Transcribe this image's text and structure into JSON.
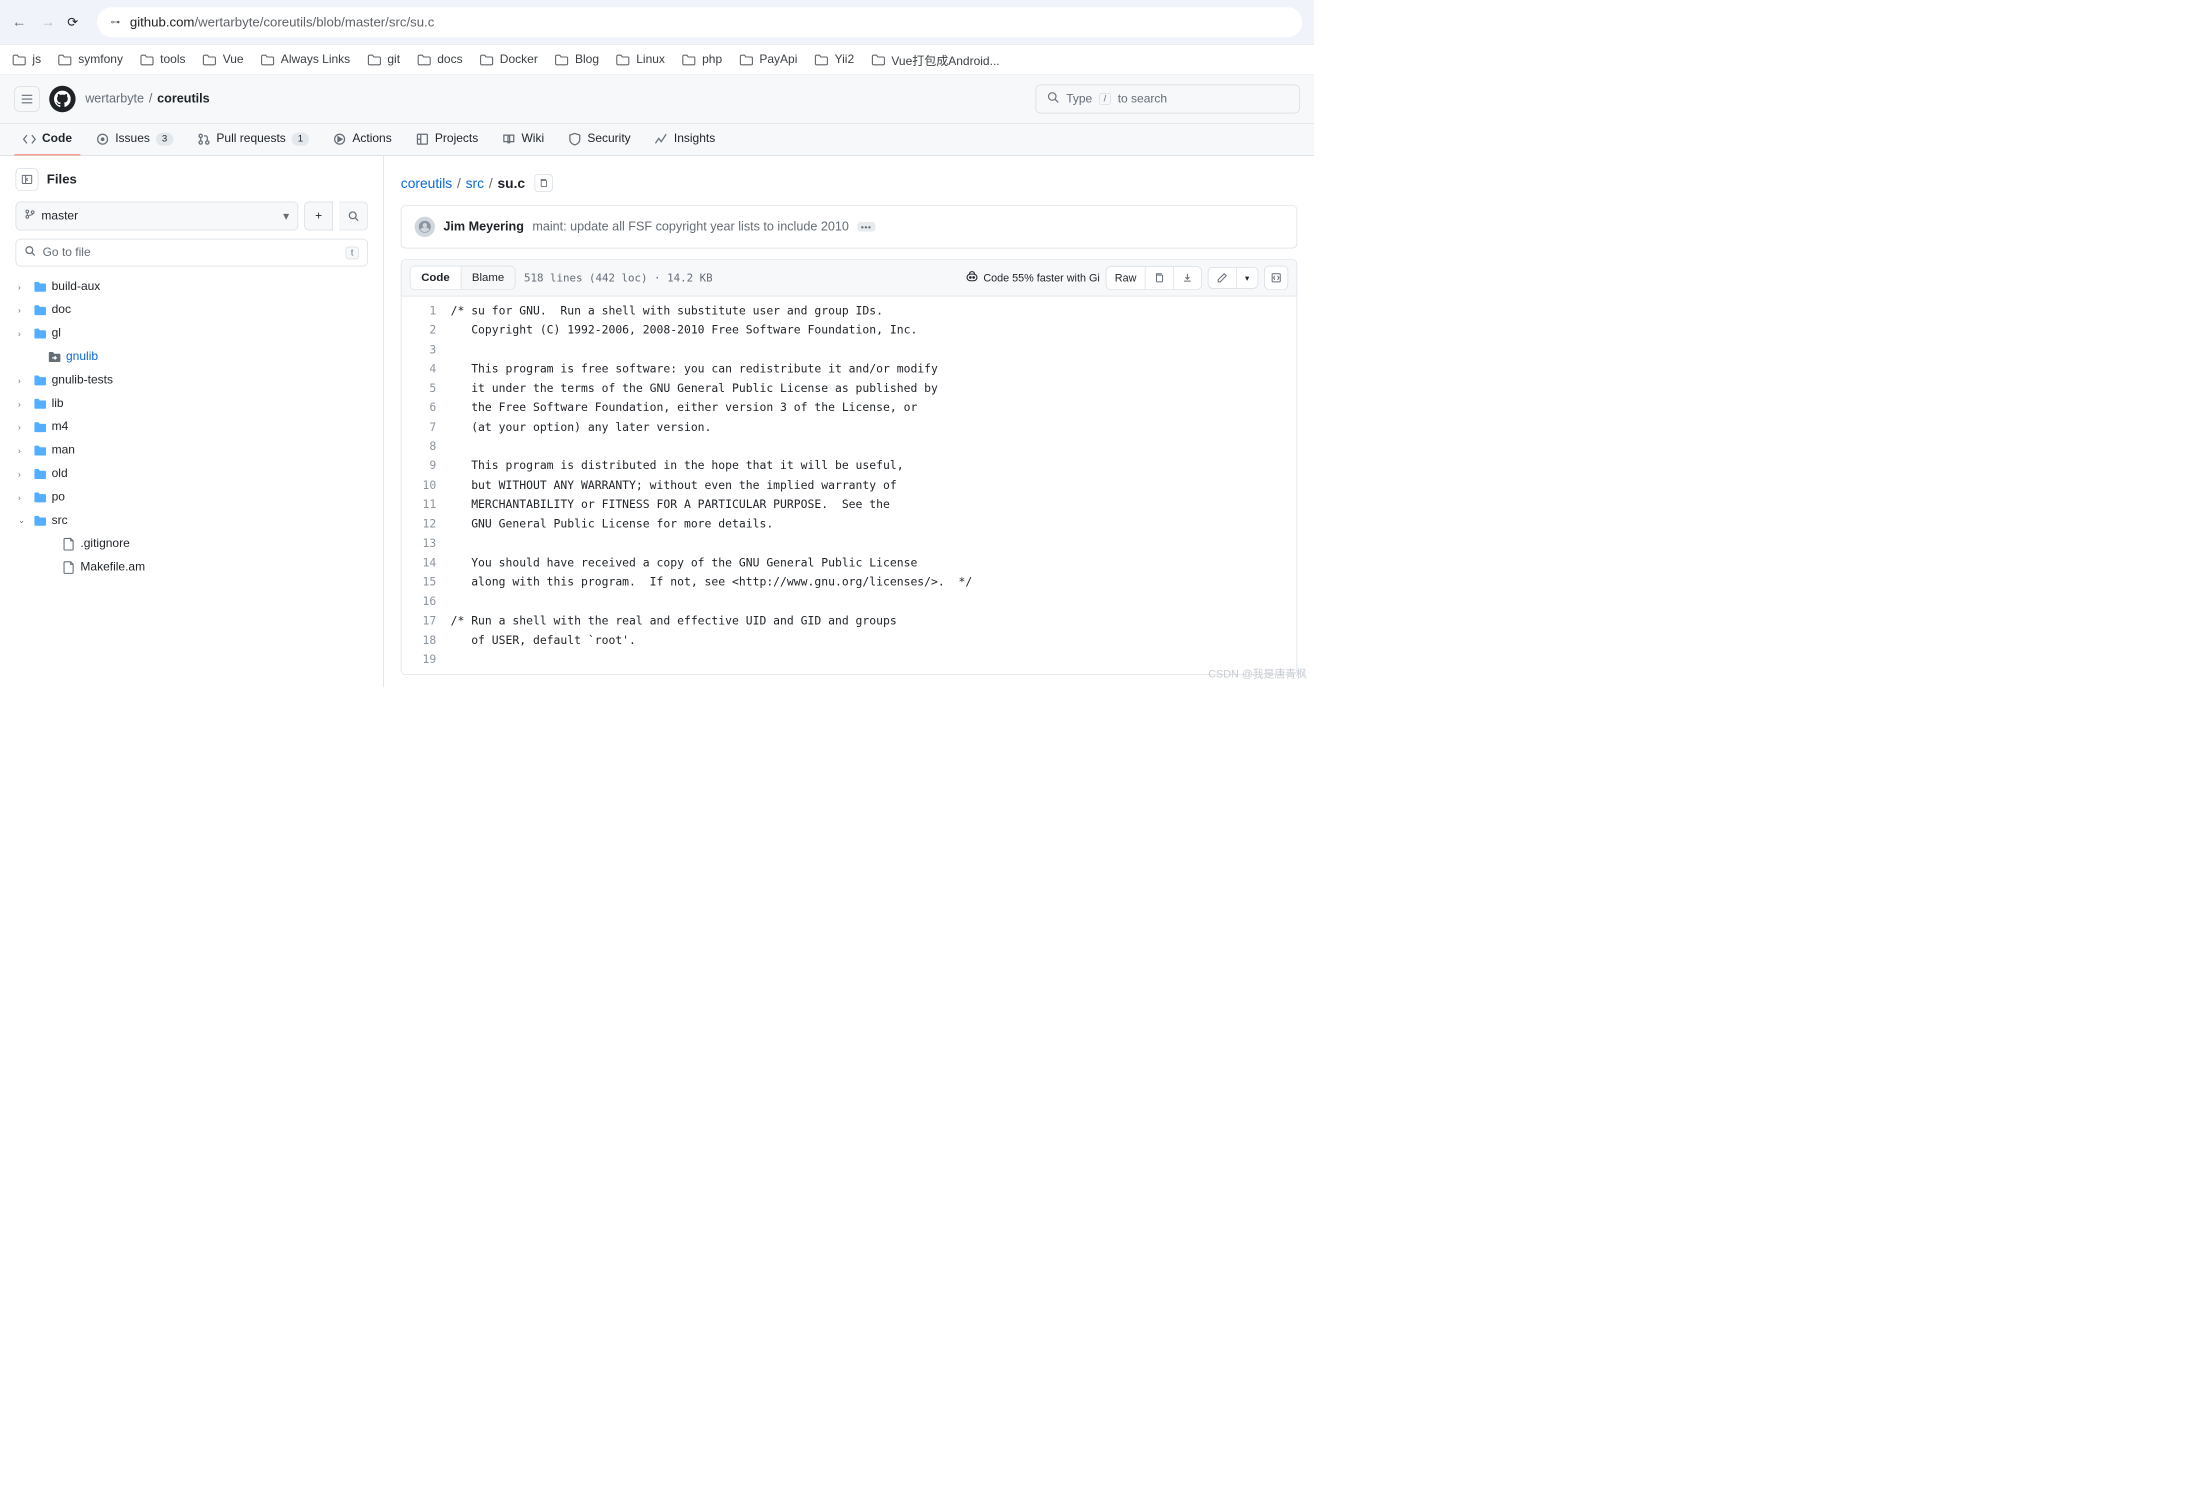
{
  "browser": {
    "url_domain": "github.com",
    "url_path": "/wertarbyte/coreutils/blob/master/src/su.c",
    "bookmarks": [
      "js",
      "symfony",
      "tools",
      "Vue",
      "Always Links",
      "git",
      "docs",
      "Docker",
      "Blog",
      "Linux",
      "php",
      "PayApi",
      "Yii2",
      "Vue打包成Android..."
    ]
  },
  "header": {
    "owner": "wertarbyte",
    "repo": "coreutils",
    "search_placeholder_pre": "Type",
    "search_key": "/",
    "search_placeholder_post": "to search"
  },
  "tabs": {
    "code": "Code",
    "issues": "Issues",
    "issues_count": "3",
    "pulls": "Pull requests",
    "pulls_count": "1",
    "actions": "Actions",
    "projects": "Projects",
    "wiki": "Wiki",
    "security": "Security",
    "insights": "Insights"
  },
  "sidebar": {
    "title": "Files",
    "branch": "master",
    "go_to_file": "Go to file",
    "go_to_file_key": "t",
    "tree": [
      {
        "label": "build-aux",
        "type": "folder",
        "expand": true
      },
      {
        "label": "doc",
        "type": "folder",
        "expand": true
      },
      {
        "label": "gl",
        "type": "folder",
        "expand": true
      },
      {
        "label": "gnulib",
        "type": "submodule",
        "expand": false
      },
      {
        "label": "gnulib-tests",
        "type": "folder",
        "expand": true
      },
      {
        "label": "lib",
        "type": "folder",
        "expand": true
      },
      {
        "label": "m4",
        "type": "folder",
        "expand": true
      },
      {
        "label": "man",
        "type": "folder",
        "expand": true
      },
      {
        "label": "old",
        "type": "folder",
        "expand": true
      },
      {
        "label": "po",
        "type": "folder",
        "expand": true
      },
      {
        "label": "src",
        "type": "folder-open",
        "expand": true
      },
      {
        "label": ".gitignore",
        "type": "file",
        "expand": false
      },
      {
        "label": "Makefile.am",
        "type": "file",
        "expand": false
      }
    ]
  },
  "main": {
    "crumb_repo": "coreutils",
    "crumb_dir": "src",
    "crumb_file": "su.c",
    "commit_author": "Jim Meyering",
    "commit_msg": "maint: update all FSF copyright year lists to include 2010",
    "code_tab": "Code",
    "blame_tab": "Blame",
    "meta": "518 lines (442 loc) · 14.2 KB",
    "copilot": "Code 55% faster with Gi",
    "raw": "Raw"
  },
  "code_lines": [
    "/* su for GNU.  Run a shell with substitute user and group IDs.",
    "   Copyright (C) 1992-2006, 2008-2010 Free Software Foundation, Inc.",
    "",
    "   This program is free software: you can redistribute it and/or modify",
    "   it under the terms of the GNU General Public License as published by",
    "   the Free Software Foundation, either version 3 of the License, or",
    "   (at your option) any later version.",
    "",
    "   This program is distributed in the hope that it will be useful,",
    "   but WITHOUT ANY WARRANTY; without even the implied warranty of",
    "   MERCHANTABILITY or FITNESS FOR A PARTICULAR PURPOSE.  See the",
    "   GNU General Public License for more details.",
    "",
    "   You should have received a copy of the GNU General Public License",
    "   along with this program.  If not, see <http://www.gnu.org/licenses/>.  */",
    "",
    "/* Run a shell with the real and effective UID and GID and groups",
    "   of USER, default `root'.",
    ""
  ],
  "watermark": "CSDN @我是唐青枫"
}
